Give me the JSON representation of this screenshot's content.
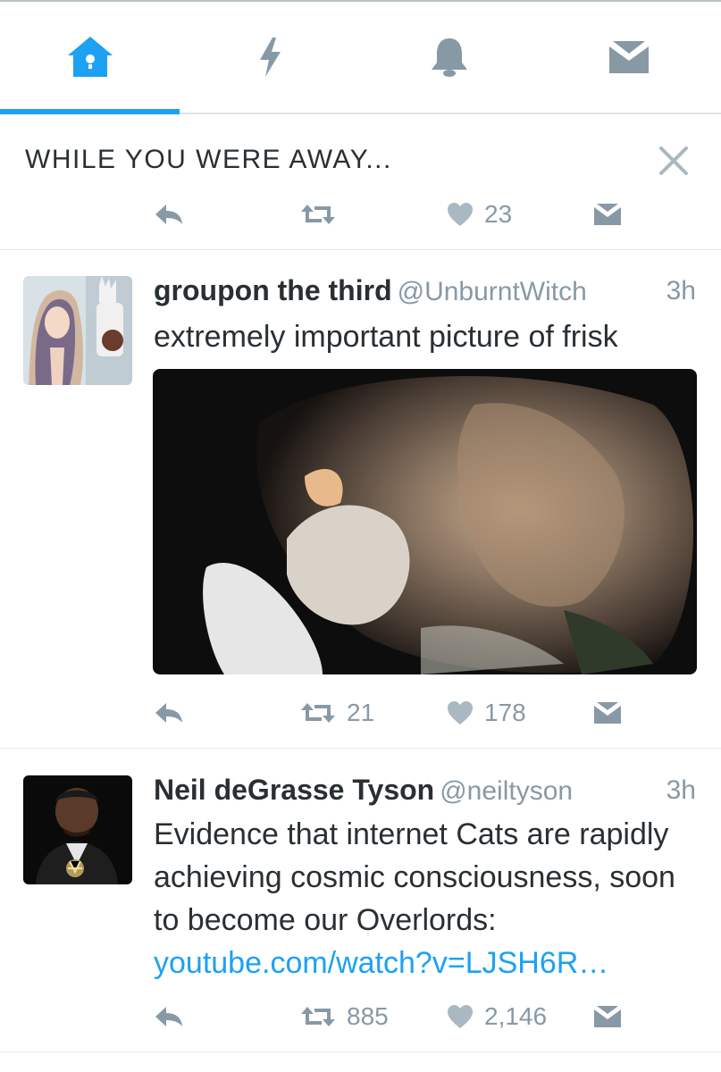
{
  "tabs": [
    {
      "name": "Home",
      "icon": "home-icon",
      "active": true
    },
    {
      "name": "Moments",
      "icon": "lightning-icon",
      "active": false
    },
    {
      "name": "Notifications",
      "icon": "bell-icon",
      "active": false
    },
    {
      "name": "Messages",
      "icon": "envelope-icon",
      "active": false
    }
  ],
  "away": {
    "title": "WHILE YOU WERE AWAY...",
    "actions": {
      "like_count": "23"
    }
  },
  "tweets": [
    {
      "name": "groupon the third",
      "handle": "@UnburntWitch",
      "time": "3h",
      "text": "extremely important picture of frisk",
      "retweet_count": "21",
      "like_count": "178"
    },
    {
      "name": "Neil deGrasse Tyson",
      "handle": "@neiltyson",
      "time": "3h",
      "text": "Evidence that internet Cats are rapidly achieving cosmic consciousness, soon to become our Overlords:",
      "link": "youtube.com/watch?v=LJSH6R…",
      "retweet_count": "885",
      "like_count": "2,146"
    }
  ],
  "colors": {
    "accent": "#1da1f2",
    "icon_gray": "#8899a6",
    "icon_light": "#aab8c2",
    "text": "#292f33",
    "divider": "#e1e8ed"
  }
}
